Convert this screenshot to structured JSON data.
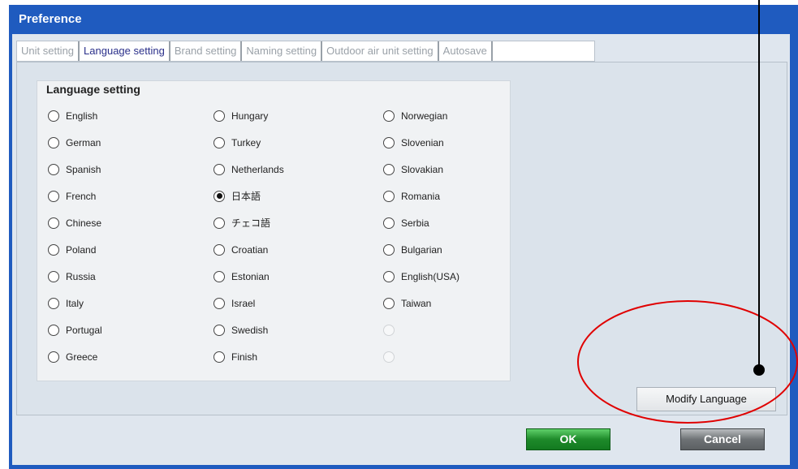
{
  "window": {
    "title": "Preference"
  },
  "tabs": [
    {
      "label": "Unit setting",
      "active": false
    },
    {
      "label": "Language setting",
      "active": true
    },
    {
      "label": "Brand setting",
      "active": false
    },
    {
      "label": "Naming setting",
      "active": false
    },
    {
      "label": "Outdoor air unit setting",
      "active": false
    },
    {
      "label": "Autosave",
      "active": false
    }
  ],
  "language_group": {
    "title": "Language setting",
    "columns": [
      [
        "English",
        "German",
        "Spanish",
        "French",
        "Chinese",
        "Poland",
        "Russia",
        "Italy",
        "Portugal",
        "Greece"
      ],
      [
        "Hungary",
        "Turkey",
        "Netherlands",
        "日本語",
        "チェコ語",
        "Croatian",
        "Estonian",
        "Israel",
        "Swedish",
        "Finish"
      ],
      [
        "Norwegian",
        "Slovenian",
        "Slovakian",
        "Romania",
        "Serbia",
        "Bulgarian",
        "English(USA)",
        "Taiwan",
        "",
        ""
      ]
    ],
    "selected": "日本語"
  },
  "buttons": {
    "modify_language": "Modify Language",
    "ok": "OK",
    "cancel": "Cancel"
  },
  "colors": {
    "title_bar": "#1f5bbf",
    "annotation_circle": "#e00000",
    "ok_button": "#1e8a2a",
    "cancel_button": "#6e7275"
  }
}
